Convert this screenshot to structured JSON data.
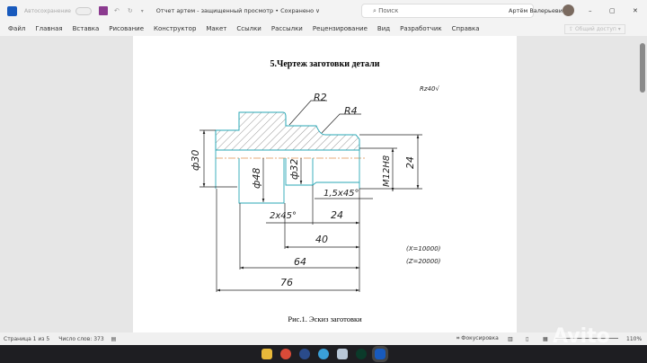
{
  "titlebar": {
    "autosave": "Автосохранение",
    "doc_title": "Отчет артем  -  защищенный просмотр • Сохранено ∨",
    "search_placeholder": "Поиск",
    "user": "Артём Валерьевич",
    "share": "Общий доступ"
  },
  "menu": [
    "Файл",
    "Главная",
    "Вставка",
    "Рисование",
    "Конструктор",
    "Макет",
    "Ссылки",
    "Рассылки",
    "Рецензирование",
    "Вид",
    "Разработчик",
    "Справка"
  ],
  "document": {
    "heading": "5.Чертеж заготовки детали",
    "caption": "Рис.1. Эскиз заготовки",
    "drawing": {
      "roughness": "Rz40√",
      "r2": "R2",
      "r4": "R4",
      "d30": "ф30",
      "d48": "ф48",
      "d32": "ф32",
      "m12": "M12H8",
      "dim24_right": "24",
      "chamfer1": "1,5x45°",
      "chamfer2": "2x45°",
      "dim24": "24",
      "dim40": "40",
      "dim64": "64",
      "dim76": "76",
      "x_note": "(X=10000)",
      "z_note": "(Z=20000)"
    }
  },
  "status": {
    "page": "Страница 1 из 5",
    "words": "Число слов: 373",
    "focus": "Фокусировка",
    "zoom": "110%"
  },
  "watermark": "Avito",
  "taskbar_icons": [
    "file-explorer-icon",
    "chrome-icon",
    "steam-icon",
    "telegram-icon",
    "notes-icon",
    "app-icon",
    "word-icon"
  ]
}
